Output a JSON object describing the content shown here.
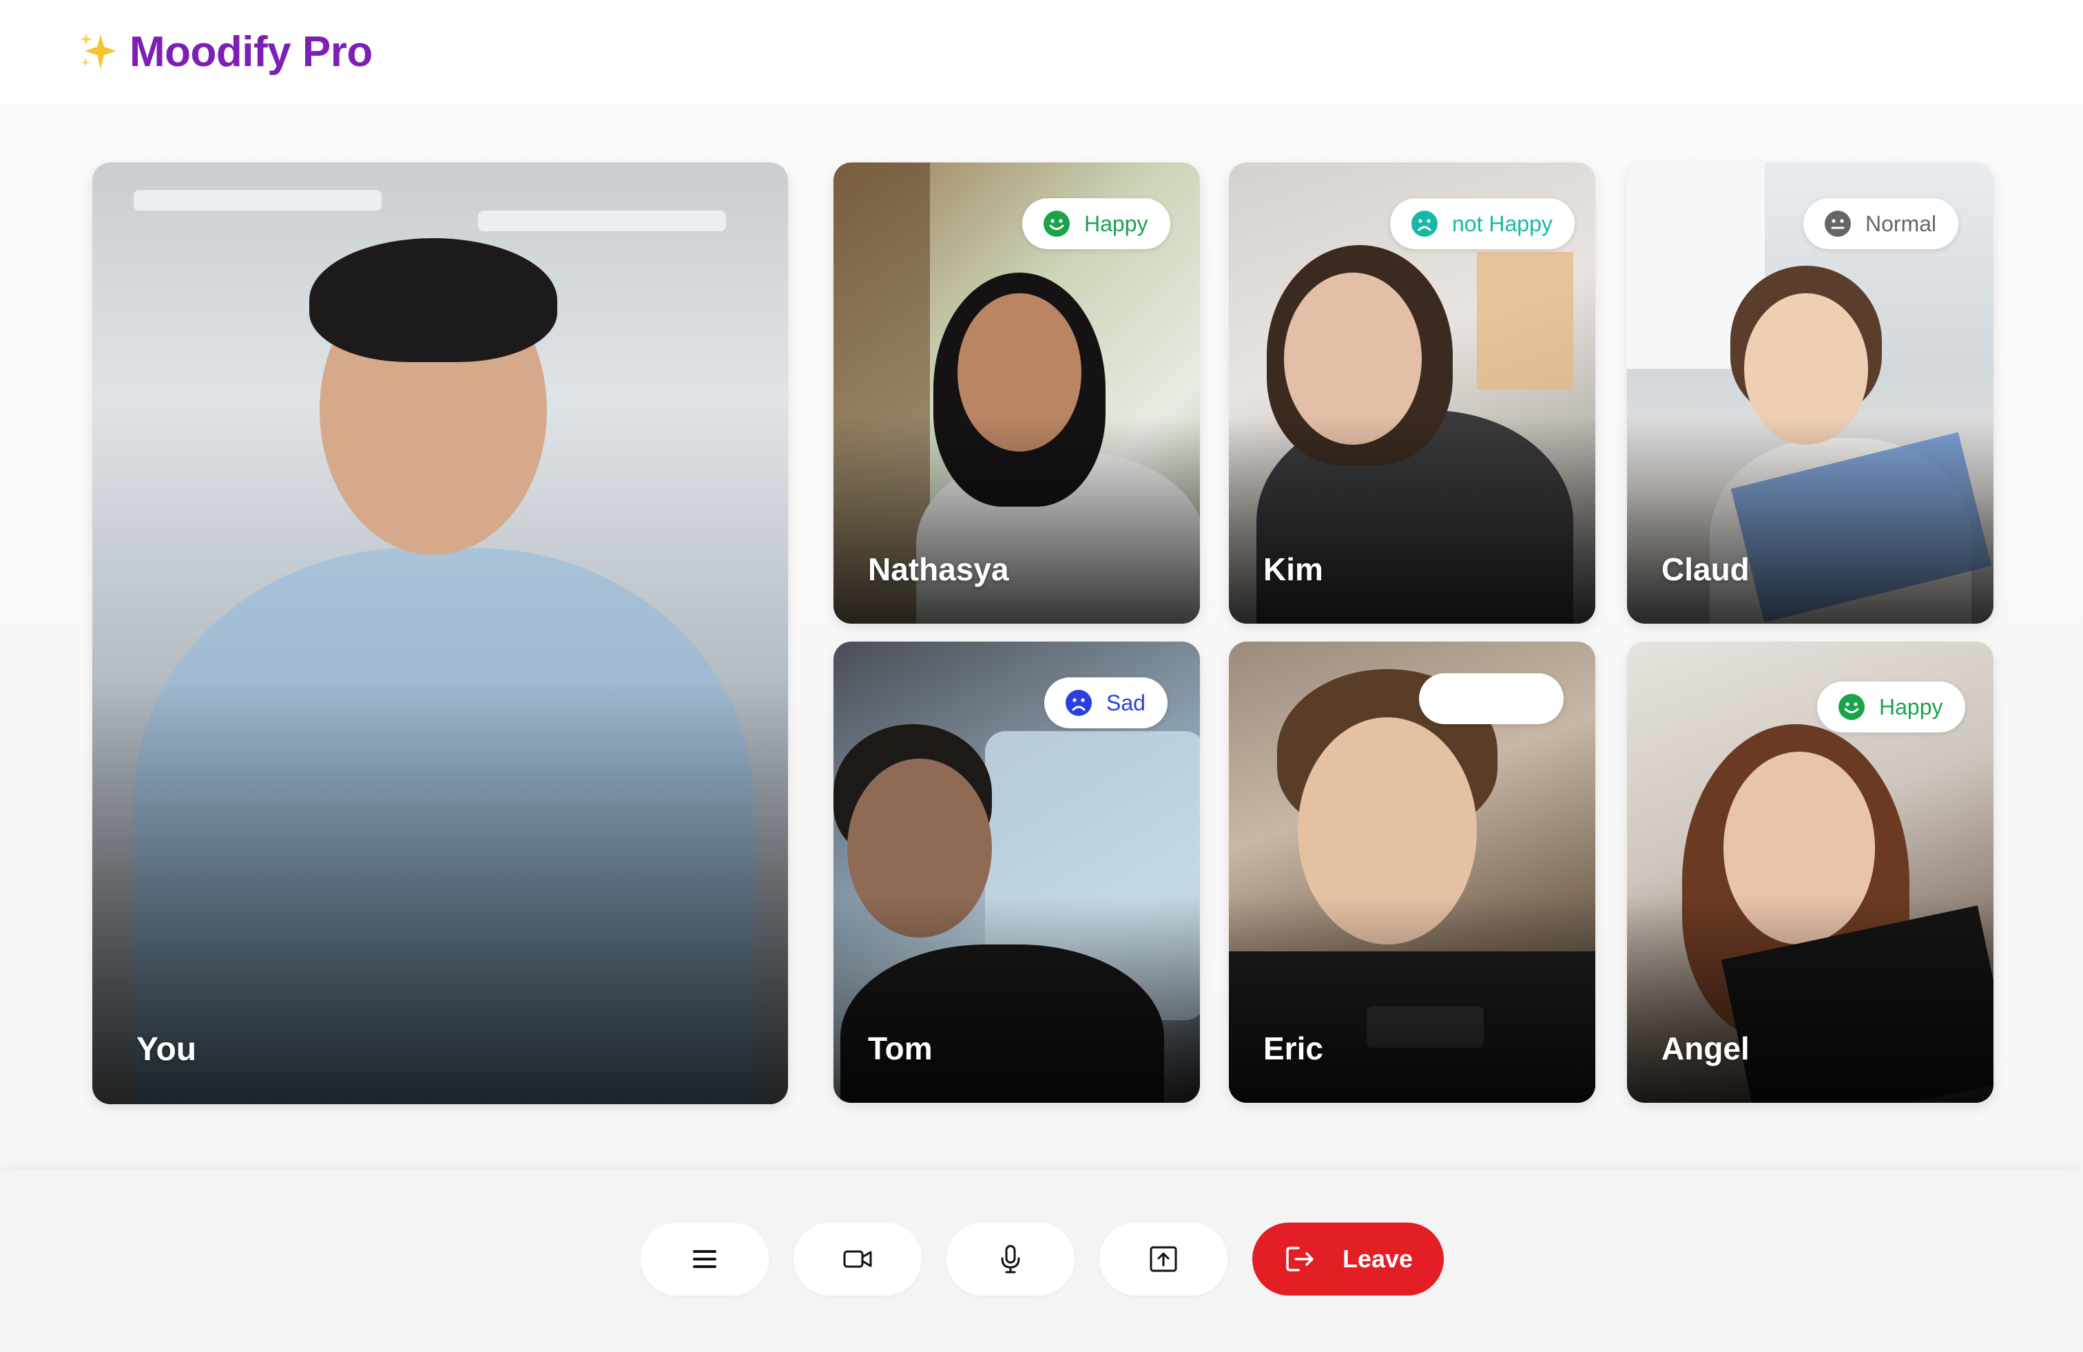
{
  "app": {
    "title": "Moodify Pro"
  },
  "participants": {
    "self": {
      "name": "You"
    },
    "tiles": [
      {
        "name": "Nathasya",
        "mood": "Happy",
        "mood_icon": "happy-face-icon",
        "mood_color": "#1aa34a"
      },
      {
        "name": "Kim",
        "mood": "not Happy",
        "mood_icon": "frown-face-icon",
        "mood_color": "#16b9a6"
      },
      {
        "name": "Claud",
        "mood": "Normal",
        "mood_icon": "neutral-face-icon",
        "mood_color": "#666666"
      },
      {
        "name": "Tom",
        "mood": "Sad",
        "mood_icon": "sad-face-icon",
        "mood_color": "#2b3fe0"
      },
      {
        "name": "Eric",
        "mood": "",
        "mood_icon": "",
        "mood_color": ""
      },
      {
        "name": "Angel",
        "mood": "Happy",
        "mood_icon": "happy-face-icon",
        "mood_color": "#1aa34a"
      }
    ]
  },
  "controls": {
    "menu_icon": "menu-icon",
    "camera_icon": "video-camera-icon",
    "mic_icon": "microphone-icon",
    "share_icon": "share-screen-icon",
    "leave_icon": "leave-icon",
    "leave_label": "Leave",
    "leave_color": "#e31e25"
  },
  "colors": {
    "brand": "#7d1fb5",
    "happy": "#1aa34a",
    "not_happy": "#16b9a6",
    "normal": "#666666",
    "sad": "#2b3fe0"
  }
}
